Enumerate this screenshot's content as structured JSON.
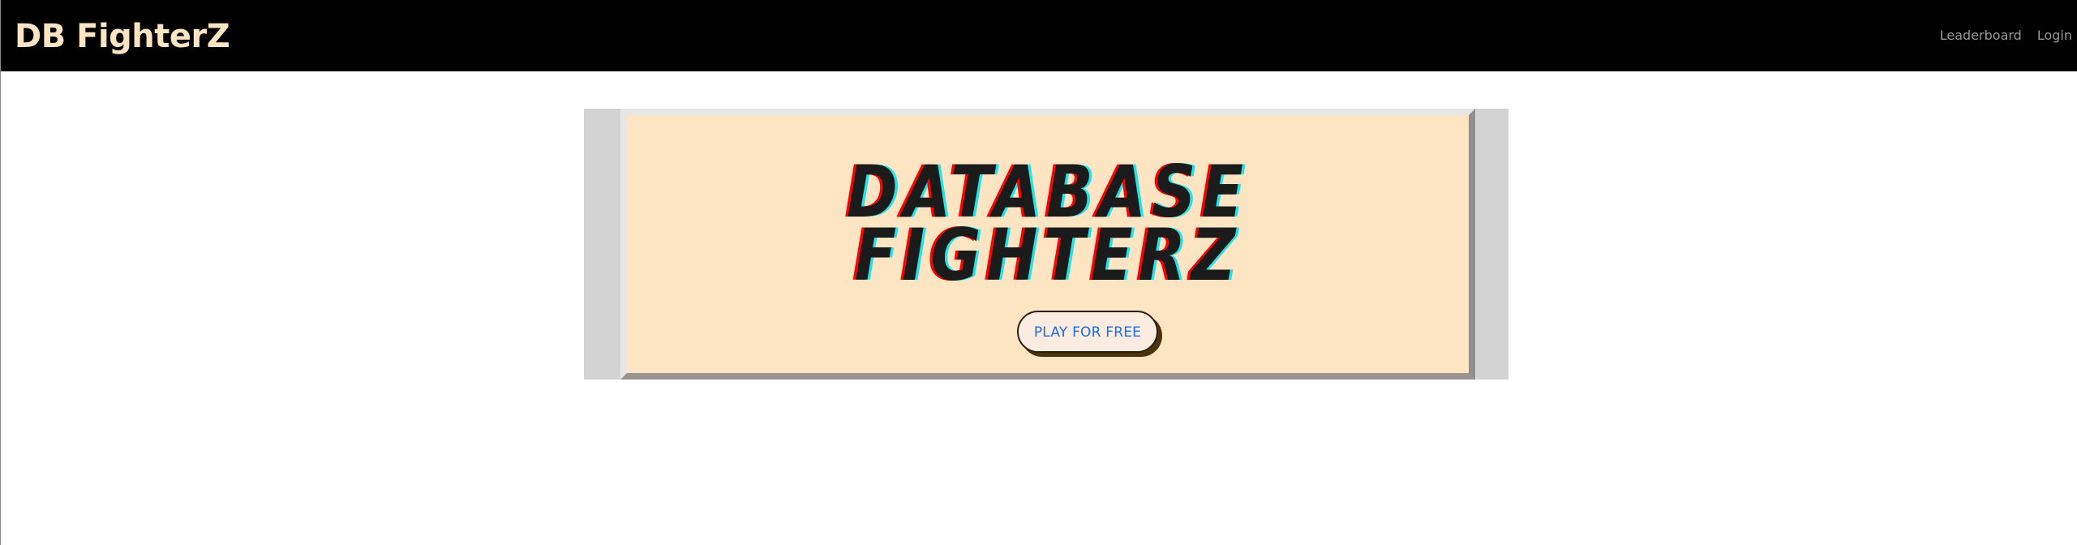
{
  "navbar": {
    "brand": "DB FighterZ",
    "links": [
      {
        "label": "Leaderboard"
      },
      {
        "label": "Login"
      }
    ]
  },
  "hero": {
    "title_line1": "DATABASE",
    "title_line2": "FIGHTERZ",
    "cta_label": "PLAY FOR FREE"
  },
  "colors": {
    "navbar_bg": "#000000",
    "brand_text": "#fde4c2",
    "hero_bg": "#fde4c2",
    "hero_frame": "#d3d3d3",
    "title_text": "#1b1b1b",
    "title_shadow_left": "#ff0000",
    "title_shadow_right": "#22e3e8",
    "cta_text": "#1a6de3"
  }
}
